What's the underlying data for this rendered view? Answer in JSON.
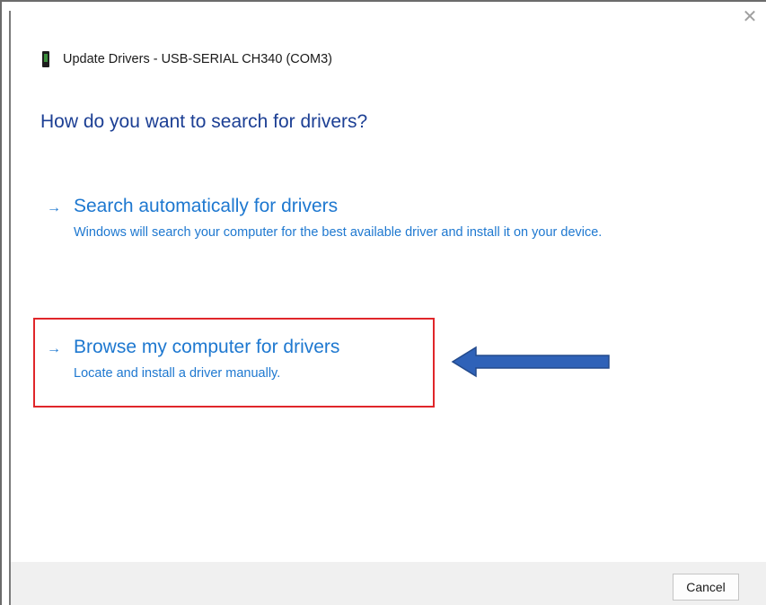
{
  "window": {
    "title": "Update Drivers - USB-SERIAL CH340 (COM3)",
    "close_glyph": "✕"
  },
  "heading": "How do you want to search for drivers?",
  "options": [
    {
      "arrow": "→",
      "title": "Search automatically for drivers",
      "description": "Windows will search your computer for the best available driver and install it on your device."
    },
    {
      "arrow": "→",
      "title": "Browse my computer for drivers",
      "description": "Locate and install a driver manually."
    }
  ],
  "footer": {
    "cancel_label": "Cancel"
  },
  "colors": {
    "heading": "#1c3f94",
    "link": "#1e78d0",
    "highlight_border": "#e0262a",
    "annotation_arrow": "#2f62b8",
    "footer_bg": "#f0f0f0"
  },
  "icons": {
    "device": "usb-device-icon",
    "close": "close-icon",
    "option_arrow": "arrow-right-icon",
    "annotation": "annotation-arrow-left-icon"
  }
}
